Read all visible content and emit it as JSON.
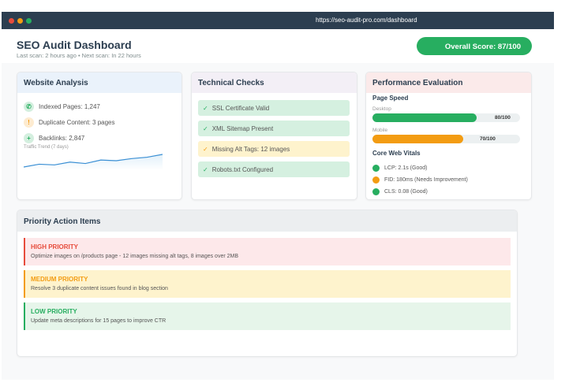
{
  "browser": {
    "url": "https://seo-audit-pro.com/dashboard"
  },
  "header": {
    "title": "SEO Audit Dashboard",
    "subtitle": "Last scan: 2 hours ago • Next scan: In 22 hours",
    "score": "Overall Score: 87/100"
  },
  "website_analysis": {
    "title": "Website Analysis",
    "items": [
      {
        "label": "Indexed Pages: 1,247",
        "icon": "phone-icon"
      },
      {
        "label": "Duplicate Content: 3 pages",
        "icon": "warning-icon"
      },
      {
        "label": "Backlinks: 2,847",
        "icon": "plus-icon"
      }
    ],
    "trend_label": "Traffic Trend (7 days)",
    "trend": [
      2,
      4,
      3.5,
      5.5,
      4.5,
      7,
      6.5,
      8,
      9,
      11
    ]
  },
  "technical": {
    "title": "Technical Checks",
    "items": [
      {
        "label": "SSL Certificate Valid",
        "status": "ok"
      },
      {
        "label": "XML Sitemap Present",
        "status": "ok"
      },
      {
        "label": "Missing Alt Tags: 12 images",
        "status": "warn"
      },
      {
        "label": "Robots.txt Configured",
        "status": "ok"
      }
    ]
  },
  "performance": {
    "title": "Performance Evaluation",
    "speed_title": "Page Speed",
    "desktop": {
      "label": "Desktop",
      "value": "80/100",
      "pct": 80
    },
    "mobile": {
      "label": "Mobile",
      "value": "70/100",
      "pct": 70
    },
    "vitals_title": "Core Web Vitals",
    "vitals": [
      {
        "label": "LCP: 2.1s (Good)",
        "color": "#27ae60"
      },
      {
        "label": "FID: 180ms (Needs Improvement)",
        "color": "#f39c12"
      },
      {
        "label": "CLS: 0.08 (Good)",
        "color": "#27ae60"
      }
    ]
  },
  "priority": {
    "title": "Priority Action Items",
    "items": [
      {
        "level": "HIGH PRIORITY",
        "desc": "Optimize images on /products page - 12 images missing alt tags, 8 images over 2MB"
      },
      {
        "level": "MEDIUM PRIORITY",
        "desc": "Resolve 3 duplicate content issues found in blog section"
      },
      {
        "level": "LOW PRIORITY",
        "desc": "Update meta descriptions for 15 pages to improve CTR"
      }
    ]
  },
  "colors": {
    "green": "#27ae60",
    "orange": "#f39c12",
    "red": "#e74c3c",
    "dark": "#2c3e50"
  }
}
